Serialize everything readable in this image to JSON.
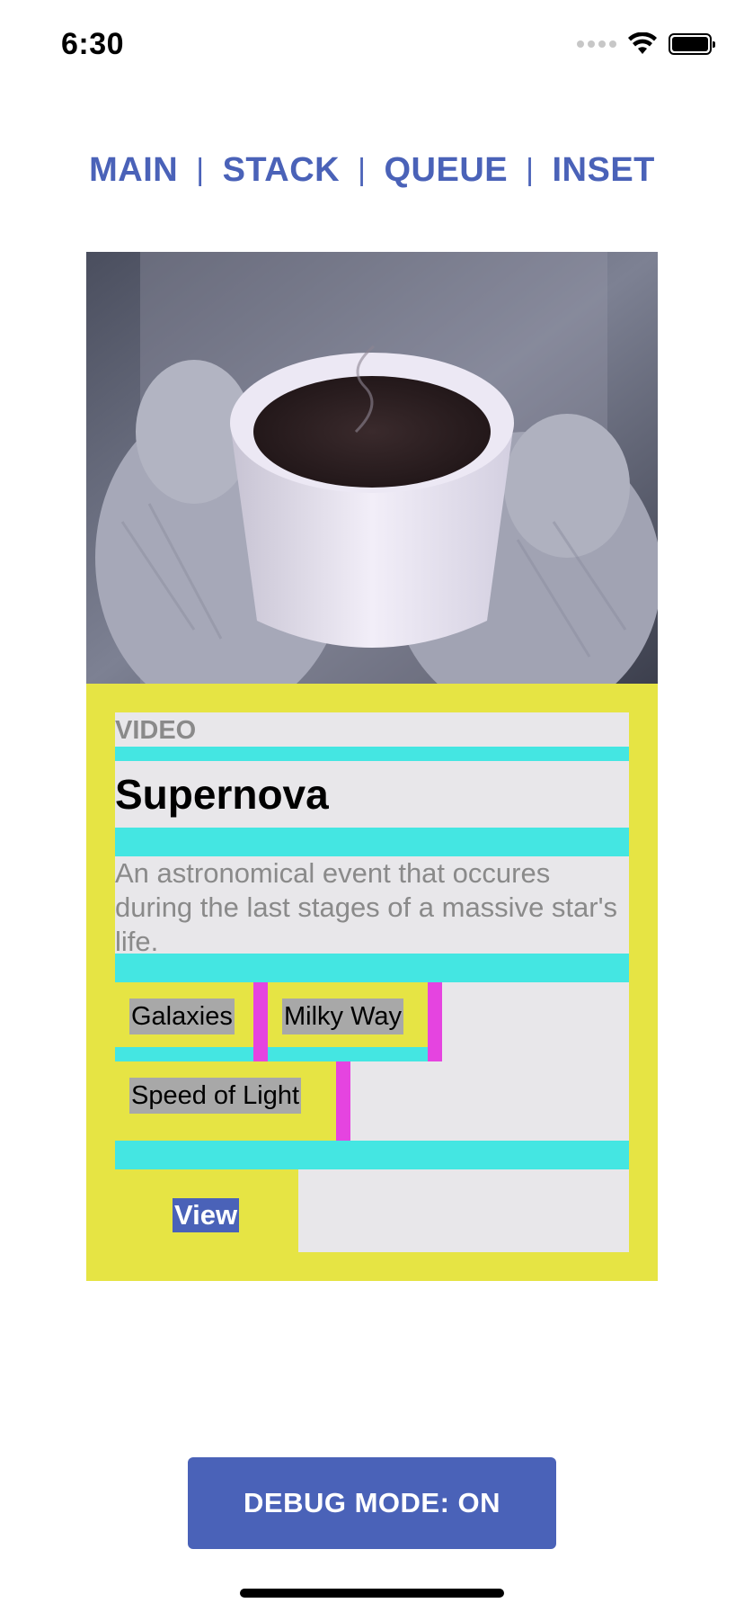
{
  "status_bar": {
    "time": "6:30"
  },
  "nav": {
    "items": [
      {
        "label": "MAIN"
      },
      {
        "label": "STACK"
      },
      {
        "label": "QUEUE"
      },
      {
        "label": "INSET"
      }
    ],
    "separator": "|"
  },
  "card": {
    "kind": "VIDEO",
    "title": "Supernova",
    "description": "An astronomical event that occures during the last stages of a massive star's life.",
    "tags": [
      "Galaxies",
      "Milky Way",
      "Speed of Light"
    ],
    "action_label": "View"
  },
  "debug_button": {
    "label": "DEBUG MODE: ON"
  },
  "colors": {
    "accent": "#4a62b8",
    "card_background": "#e6e444",
    "content_background": "#e8e7ea",
    "vertical_spacer": "#44e6e2",
    "horizontal_spacer": "#e544e0",
    "tag_background": "#a8a8a8"
  },
  "icons": [
    "cellular-signal-icon",
    "wifi-icon",
    "battery-icon"
  ]
}
